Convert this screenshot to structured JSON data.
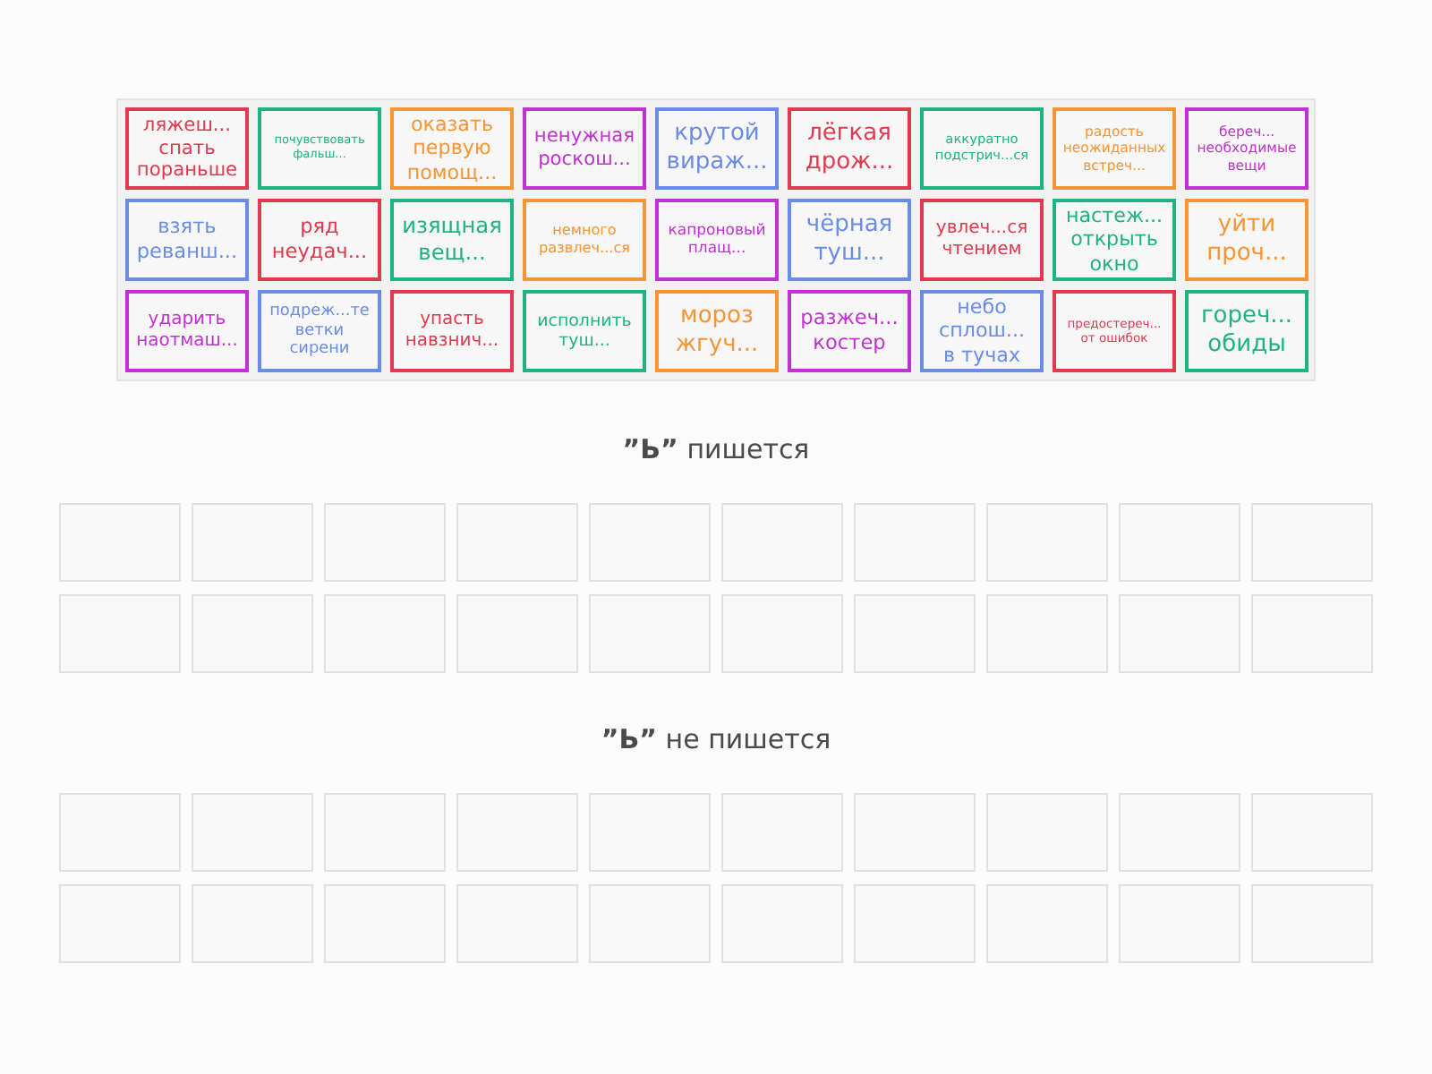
{
  "cards": [
    {
      "text": "ляжеш...\nспать\nпораньше",
      "color": "#e03a4e"
    },
    {
      "text": "почувствовать\nфальш...",
      "color": "#1fb380"
    },
    {
      "text": "оказать\nпервую\nпомощ...",
      "color": "#f79433"
    },
    {
      "text": "ненужная\nроскош...",
      "color": "#c130d1"
    },
    {
      "text": "крутой\nвираж...",
      "color": "#6a8ce6"
    },
    {
      "text": "лёгкая\nдрож...",
      "color": "#e03a4e"
    },
    {
      "text": "аккуратно\nподстрич...ся",
      "color": "#1fb380"
    },
    {
      "text": "радость\nнеожиданных\nвстреч...",
      "color": "#f79433"
    },
    {
      "text": "береч...\nнеобходимые\nвещи",
      "color": "#c130d1"
    },
    {
      "text": "взять\nреванш...",
      "color": "#6a8ce6"
    },
    {
      "text": "ряд\nнеудач...",
      "color": "#e03a4e"
    },
    {
      "text": "изящная\nвещ...",
      "color": "#1fb380"
    },
    {
      "text": "немного\nразвлеч...ся",
      "color": "#f79433"
    },
    {
      "text": "капроновый\nплащ...",
      "color": "#c130d1"
    },
    {
      "text": "чёрная\nтуш...",
      "color": "#6a8ce6"
    },
    {
      "text": "увлеч...ся\nчтением",
      "color": "#e03a4e"
    },
    {
      "text": "настеж...\nоткрыть\nокно",
      "color": "#1fb380"
    },
    {
      "text": "уйти\nпроч...",
      "color": "#f79433"
    },
    {
      "text": "ударить\nнаотмаш...",
      "color": "#c130d1"
    },
    {
      "text": "подреж...те\nветки\nсирени",
      "color": "#6a8ce6"
    },
    {
      "text": "упасть\nнавзнич...",
      "color": "#e03a4e"
    },
    {
      "text": "исполнить\nтуш...",
      "color": "#1fb380"
    },
    {
      "text": "мороз\nжгуч...",
      "color": "#f79433"
    },
    {
      "text": "разжеч...\nкостер",
      "color": "#c130d1"
    },
    {
      "text": "небо\nсплош...\nв тучах",
      "color": "#6a8ce6"
    },
    {
      "text": "предостереч...\nот ошибок",
      "color": "#e03a4e"
    },
    {
      "text": "гореч...\nобиды",
      "color": "#1fb380"
    }
  ],
  "groups": [
    {
      "heading": "**”Ь”** пишется",
      "slots": [
        {
          "filled": false
        },
        {
          "filled": false
        },
        {
          "filled": false
        },
        {
          "filled": false
        },
        {
          "filled": false
        },
        {
          "filled": false
        },
        {
          "filled": false
        },
        {
          "filled": false
        },
        {
          "filled": false
        },
        {
          "filled": false
        },
        {
          "filled": false
        },
        {
          "filled": false
        },
        {
          "filled": false
        },
        {
          "filled": false
        },
        {
          "filled": false
        },
        {
          "filled": false
        },
        {
          "filled": false
        },
        {
          "filled": false
        },
        {
          "filled": false
        },
        {
          "filled": false
        }
      ]
    },
    {
      "heading": "**”Ь”** не пишется",
      "slots": [
        {
          "filled": false
        },
        {
          "filled": false
        },
        {
          "filled": false
        },
        {
          "filled": false
        },
        {
          "filled": false
        },
        {
          "filled": false
        },
        {
          "filled": false
        },
        {
          "filled": false
        },
        {
          "filled": false
        },
        {
          "filled": false
        },
        {
          "filled": false
        },
        {
          "filled": false
        },
        {
          "filled": false
        },
        {
          "filled": false
        },
        {
          "filled": false
        },
        {
          "filled": false
        },
        {
          "filled": false
        },
        {
          "filled": false
        },
        {
          "filled": false
        },
        {
          "filled": false
        }
      ]
    }
  ]
}
